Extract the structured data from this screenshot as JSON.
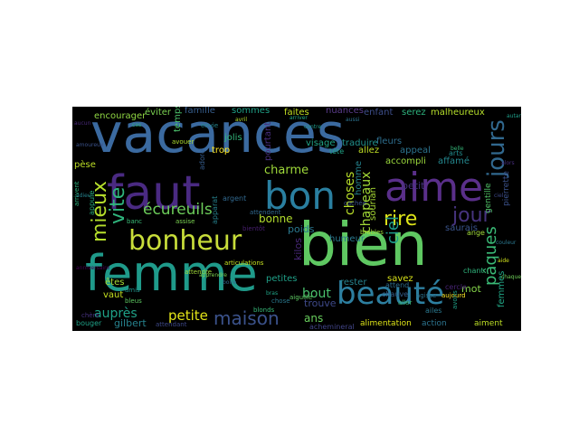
{
  "words": [
    {
      "text": "vacances",
      "color": "#3b6aa0"
    },
    {
      "text": "faut",
      "color": "#4a2a82"
    },
    {
      "text": "bon",
      "color": "#2a7fa0"
    },
    {
      "text": "aime",
      "color": "#5a2f8a"
    },
    {
      "text": "bien",
      "color": "#5fc862"
    },
    {
      "text": "femme",
      "color": "#1f9a8a"
    },
    {
      "text": "bonheur",
      "color": "#c8dd3a"
    },
    {
      "text": "beauté",
      "color": "#2d7fa0"
    },
    {
      "text": "jours",
      "color": "#31688e"
    },
    {
      "text": "jour",
      "color": "#46337e"
    },
    {
      "text": "mieux",
      "color": "#b5de2b"
    },
    {
      "text": "vite",
      "color": "#2fb47c"
    },
    {
      "text": "écureuils",
      "color": "#6ccd5a"
    },
    {
      "text": "charme",
      "color": "#9fda3a"
    },
    {
      "text": "rire",
      "color": "#dde318"
    },
    {
      "text": "chapeaux",
      "color": "#a2da37"
    },
    {
      "text": "choses",
      "color": "#b8de29"
    },
    {
      "text": "pâques",
      "color": "#3aba76"
    },
    {
      "text": "maison",
      "color": "#3b528b"
    },
    {
      "text": "petite",
      "color": "#e3e418"
    },
    {
      "text": "auprès",
      "color": "#1fa187"
    },
    {
      "text": "gilbert",
      "color": "#26828e"
    },
    {
      "text": "bout",
      "color": "#4ac16d"
    },
    {
      "text": "ans",
      "color": "#67cc5c"
    },
    {
      "text": "trouve",
      "color": "#3e4989"
    },
    {
      "text": "bonne",
      "color": "#b2dd2d"
    },
    {
      "text": "kilos",
      "color": "#482878"
    },
    {
      "text": "poids",
      "color": "#2a788e"
    },
    {
      "text": "ciel",
      "color": "#1e9b8a"
    },
    {
      "text": "petit",
      "color": "#46327e"
    },
    {
      "text": "mot",
      "color": "#85d54a"
    },
    {
      "text": "encourager",
      "color": "#90d743"
    },
    {
      "text": "éviter",
      "color": "#7ad151"
    },
    {
      "text": "famille",
      "color": "#365d8d"
    },
    {
      "text": "sommes",
      "color": "#1fa187"
    },
    {
      "text": "faites",
      "color": "#c2df23"
    },
    {
      "text": "nuances",
      "color": "#5b3c8c"
    },
    {
      "text": "enfant",
      "color": "#3d4e8a"
    },
    {
      "text": "serez",
      "color": "#2db27d"
    },
    {
      "text": "malheureux",
      "color": "#b5de2b"
    },
    {
      "text": "temps",
      "color": "#4cc26c"
    },
    {
      "text": "jolis",
      "color": "#32b67a"
    },
    {
      "text": "trop",
      "color": "#fde725"
    },
    {
      "text": "fleurs",
      "color": "#2e6e8e"
    },
    {
      "text": "visage",
      "color": "#20a486"
    },
    {
      "text": "traduire",
      "color": "#21918c"
    },
    {
      "text": "appeal",
      "color": "#2c738e"
    },
    {
      "text": "allez",
      "color": "#c0df25"
    },
    {
      "text": "accompli",
      "color": "#9bd93c"
    },
    {
      "text": "affamé",
      "color": "#24878e"
    },
    {
      "text": "pèse",
      "color": "#bddf26"
    },
    {
      "text": "homme",
      "color": "#25838e"
    },
    {
      "text": "humeur",
      "color": "#2a788e"
    },
    {
      "text": "sourian",
      "color": "#a8db34"
    },
    {
      "text": "saurais",
      "color": "#3a548c"
    },
    {
      "text": "rester",
      "color": "#26828e"
    },
    {
      "text": "savez",
      "color": "#d8e219"
    },
    {
      "text": "pourtant",
      "color": "#472f7d"
    },
    {
      "text": "petites",
      "color": "#1fa088"
    },
    {
      "text": "femmes",
      "color": "#21a585"
    },
    {
      "text": "vaut",
      "color": "#c5e021"
    },
    {
      "text": "êtes",
      "color": "#a5db36"
    },
    {
      "text": "alimentation",
      "color": "#dde318"
    },
    {
      "text": "action",
      "color": "#2c738e"
    },
    {
      "text": "aiment",
      "color": "#bddf26"
    },
    {
      "text": "achemineral",
      "color": "#414487"
    },
    {
      "text": "chauve",
      "color": "#355f8d"
    },
    {
      "text": "argent",
      "color": "#31688e"
    },
    {
      "text": "attend",
      "color": "#2e6e8e"
    },
    {
      "text": "gentille",
      "color": "#52c569"
    },
    {
      "text": "pierrette",
      "color": "#3b528b"
    },
    {
      "text": "ange",
      "color": "#a0da39"
    },
    {
      "text": "chant",
      "color": "#2fb47c"
    },
    {
      "text": "arts",
      "color": "#228c8d"
    },
    {
      "text": "ailes",
      "color": "#2a788e"
    },
    {
      "text": "bouger",
      "color": "#1fa187"
    },
    {
      "text": "cercle",
      "color": "#482475"
    },
    {
      "text": "attendant",
      "color": "#3e4989"
    },
    {
      "text": "blonds",
      "color": "#37b878"
    },
    {
      "text": "brables",
      "color": "#9fda3a"
    },
    {
      "text": "avouer",
      "color": "#addc30"
    },
    {
      "text": "envie",
      "color": "#24868e"
    },
    {
      "text": "articulations",
      "color": "#c5e021"
    },
    {
      "text": "assise",
      "color": "#7ad151"
    },
    {
      "text": "adore",
      "color": "#365d8d"
    },
    {
      "text": "appuie",
      "color": "#29af7f"
    },
    {
      "text": "banc",
      "color": "#3aba76"
    },
    {
      "text": "bleus",
      "color": "#5ec962"
    },
    {
      "text": "amis",
      "color": "#20928c"
    },
    {
      "text": "bientôt",
      "color": "#481f70"
    },
    {
      "text": "chose",
      "color": "#2a788e"
    },
    {
      "text": "aller",
      "color": "#3dbc74"
    },
    {
      "text": "aujourd",
      "color": "#fde725"
    },
    {
      "text": "tête",
      "color": "#20a386"
    },
    {
      "text": "apparat",
      "color": "#26828e"
    },
    {
      "text": "agisse",
      "color": "#2c728e"
    },
    {
      "text": "avons",
      "color": "#1fa187"
    },
    {
      "text": "chère",
      "color": "#46327e"
    },
    {
      "text": "aiguille",
      "color": "#5ec962"
    },
    {
      "text": "arrivent",
      "color": "#2db27d"
    },
    {
      "text": "attendre",
      "color": "#a0da39"
    },
    {
      "text": "cachée",
      "color": "#3b528b"
    },
    {
      "text": "attendent",
      "color": "#31688e"
    },
    {
      "text": "aucun",
      "color": "#482878"
    },
    {
      "text": "autant",
      "color": "#1f9e89"
    },
    {
      "text": "adieu",
      "color": "#26828e"
    },
    {
      "text": "ciel",
      "color": "#3e4a89"
    },
    {
      "text": "belle",
      "color": "#35b779"
    },
    {
      "text": "avril",
      "color": "#b5de2b"
    },
    {
      "text": "couleur",
      "color": "#2a788e"
    },
    {
      "text": "anniversaire",
      "color": "#440154"
    },
    {
      "text": "arriver",
      "color": "#22a884"
    },
    {
      "text": "amoureux",
      "color": "#3b528b"
    },
    {
      "text": "apprendre",
      "color": "#7ad151"
    },
    {
      "text": "boire",
      "color": "#31688e"
    },
    {
      "text": "chaque",
      "color": "#6ece58"
    },
    {
      "text": "aussi",
      "color": "#2c728e"
    },
    {
      "text": "bras",
      "color": "#20a486"
    },
    {
      "text": "alors",
      "color": "#472d7b"
    },
    {
      "text": "cas",
      "color": "#2db27d"
    },
    {
      "text": "contre",
      "color": "#1f9a8a"
    },
    {
      "text": "aide",
      "color": "#d0e11c"
    }
  ]
}
